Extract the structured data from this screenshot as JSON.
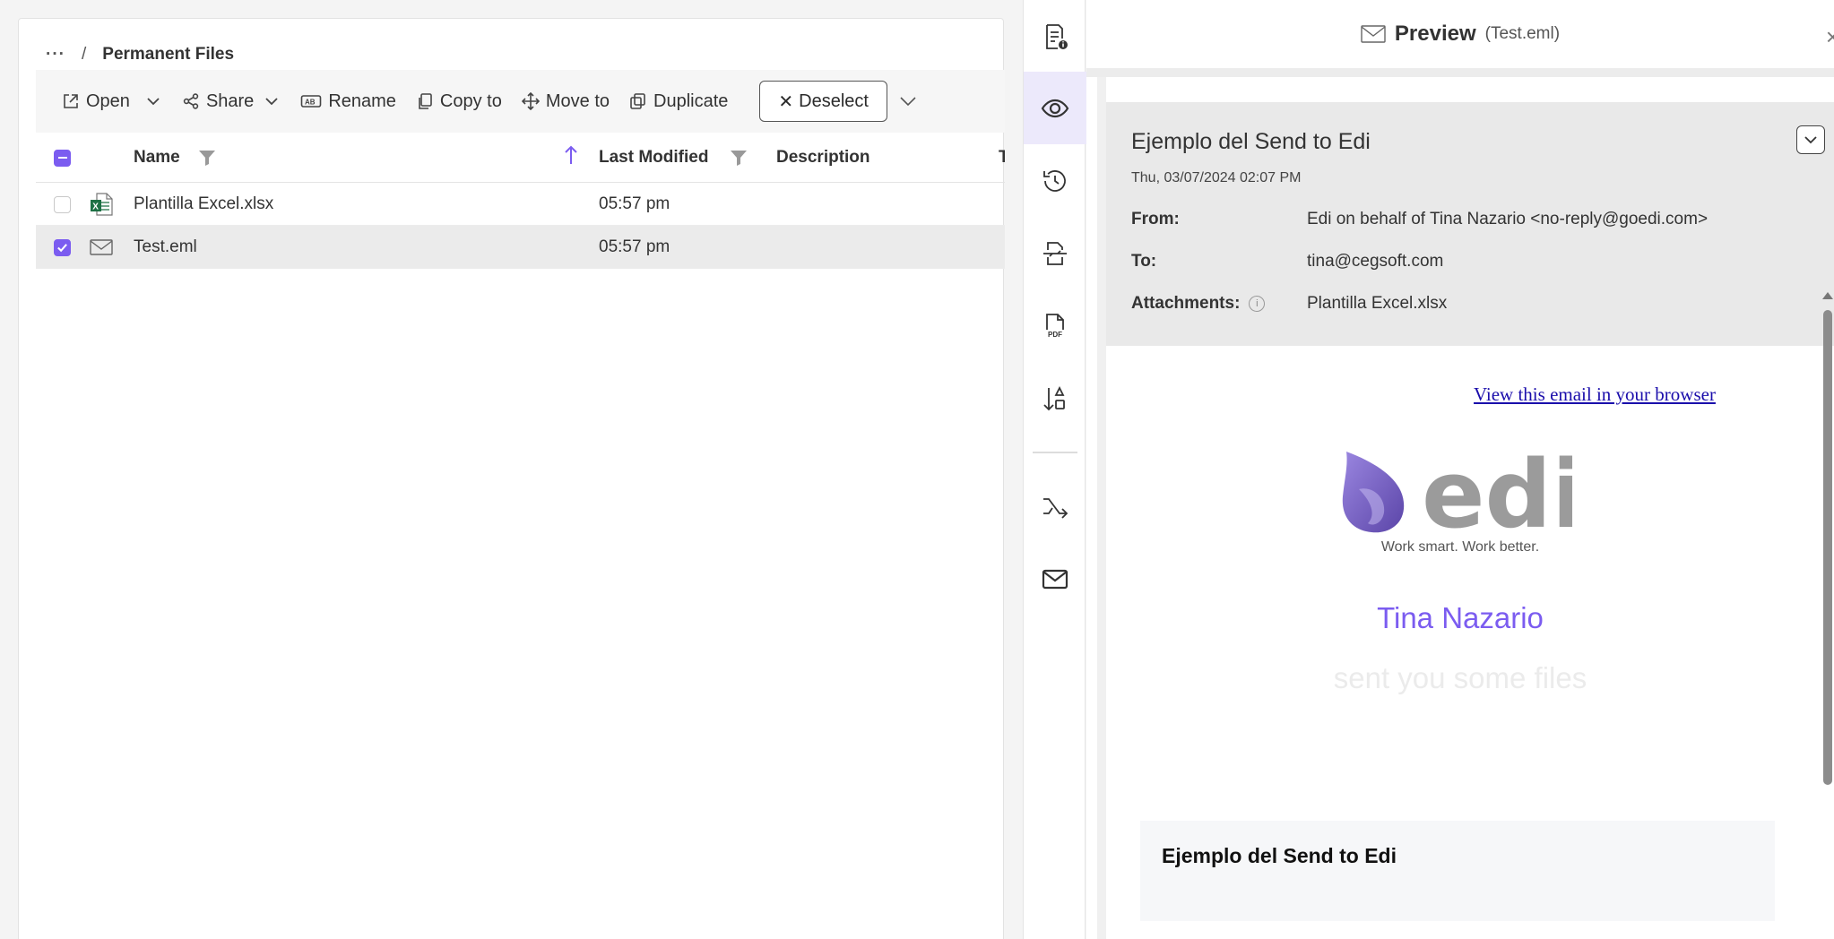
{
  "breadcrumb": {
    "dots": "···",
    "separator": "/",
    "current": "Permanent Files"
  },
  "toolbar": {
    "open": "Open",
    "share": "Share",
    "rename": "Rename",
    "copy_to": "Copy to",
    "move_to": "Move to",
    "duplicate": "Duplicate",
    "deselect": "Deselect"
  },
  "table": {
    "columns": {
      "name": "Name",
      "last_modified": "Last Modified",
      "description": "Description",
      "truncated": "T"
    },
    "rows": [
      {
        "name": "Plantilla Excel.xlsx",
        "last_modified": "05:57 pm",
        "description": "",
        "selected": false,
        "icon": "excel-file-icon"
      },
      {
        "name": "Test.eml",
        "last_modified": "05:57 pm",
        "description": "",
        "selected": true,
        "icon": "email-file-icon"
      }
    ]
  },
  "rail": {
    "items": [
      "file-info-icon",
      "preview-eye-icon",
      "history-icon",
      "convert-icon",
      "pdf-icon",
      "sort-icon",
      "workflow-icon",
      "mail-icon"
    ],
    "active": "preview-eye-icon"
  },
  "preview": {
    "title": "Preview",
    "filename": "(Test.eml)",
    "close": "×",
    "email": {
      "subject": "Ejemplo del Send to Edi",
      "date": "Thu, 03/07/2024 02:07 PM",
      "from_label": "From:",
      "from": "Edi on behalf of Tina Nazario <no-reply@goedi.com>",
      "to_label": "To:",
      "to": "tina@cegsoft.com",
      "attachments_label": "Attachments:",
      "attachments": "Plantilla Excel.xlsx",
      "info_glyph": "i"
    },
    "body": {
      "browser_link": "View this email in your browser",
      "logo_text": "edi",
      "tagline": "Work smart. Work better.",
      "recipient": "Tina Nazario",
      "message": "sent you some files",
      "content_title": "Ejemplo del Send to Edi"
    }
  },
  "colors": {
    "accent": "#7b5cf0",
    "excel_green": "#1d7044",
    "link": "#1a0dab"
  }
}
